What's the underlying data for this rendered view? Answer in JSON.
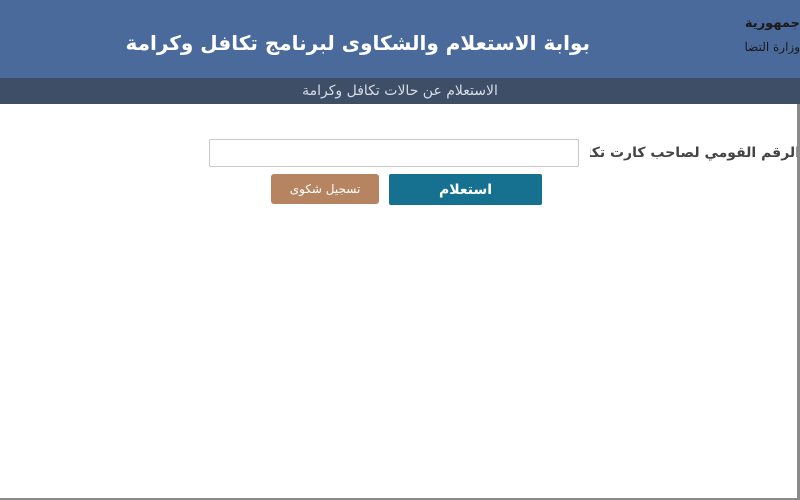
{
  "header": {
    "title": "بوابة الاستعلام والشكاوى لبرنامج تكافل وكرامة",
    "logo": {
      "line1": "جمهورية مصر العربية",
      "line2": "وزارة التضامن الاجتماعي"
    }
  },
  "subheader": {
    "title": "الاستعلام عن حالات تكافل وكرامة"
  },
  "form": {
    "label": "الرقم القومي لصاحب كارت تكافل او كرامة:",
    "input_value": "",
    "input_placeholder": ""
  },
  "buttons": {
    "inquiry": "استعلام",
    "complaint": "تسجيل شكوى"
  },
  "colors": {
    "header": "#4a6a9c",
    "subheader": "#3d4e66",
    "inquiry_button": "#16708f",
    "complaint_button": "#b78462"
  }
}
